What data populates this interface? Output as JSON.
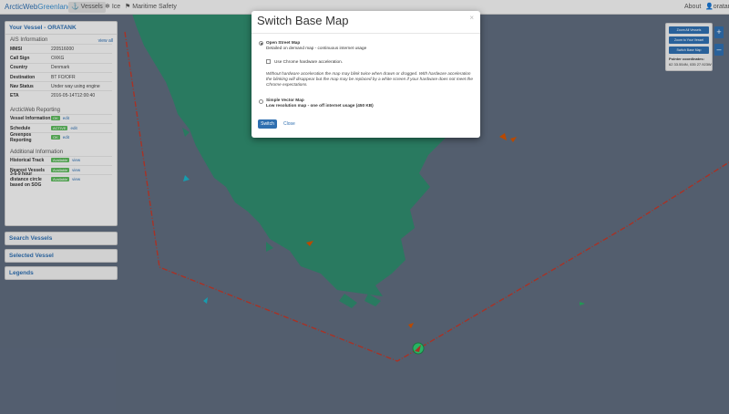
{
  "nav": {
    "brand_part1": "ArcticWeb",
    "brand_part2": "Greenland",
    "items": [
      "Vessels",
      "Ice",
      "Maritime Safety"
    ],
    "about": "About",
    "user": "oratank"
  },
  "vessel_panel": {
    "title": "Your Vessel - ORATANK",
    "ais_title": "AIS Information",
    "view_all": "view all",
    "ais_rows": [
      {
        "k": "MMSI",
        "v": "220516000"
      },
      {
        "k": "Call Sign",
        "v": "OXKG"
      },
      {
        "k": "Country",
        "v": "Denmark"
      },
      {
        "k": "Destination",
        "v": "BT FO/OFR"
      },
      {
        "k": "Nav Status",
        "v": "Under way using engine"
      },
      {
        "k": "ETA",
        "v": "2016-05-14T12:00:40"
      }
    ],
    "reporting_title": "ArcticWeb Reporting",
    "reporting_rows": [
      {
        "k": "Vessel Information",
        "badge": "OK",
        "link": "edit"
      },
      {
        "k": "Schedule",
        "badge": "ACTIVE",
        "link": "edit"
      },
      {
        "k": "Greenpos Reporting",
        "badge": "OK",
        "link": "edit"
      }
    ],
    "additional_title": "Additional Information",
    "additional_rows": [
      {
        "k": "Historical Track",
        "badge": "Available",
        "link": "view"
      },
      {
        "k": "Nearest Vessels",
        "badge": "Available",
        "link": "view"
      },
      {
        "k": "3-6-9 hour distance circle based on SOG",
        "badge": "Available",
        "link": "view"
      }
    ]
  },
  "collapsed_panels": [
    "Search Vessels",
    "Selected Vessel",
    "Legends"
  ],
  "right_panel": {
    "buttons": [
      "Zoom All Vessels",
      "Zoom to Your Vessel",
      "Switch Base Map"
    ],
    "pointer_label": "Pointer coordinates:",
    "pointer_value": "62 33.554N, 035 27.923W",
    "zoom_in": "+",
    "zoom_out": "–"
  },
  "modal": {
    "title": "Switch Base Map",
    "close_x": "×",
    "osm_title": "Open Street Map",
    "osm_desc": "Detailed on demand map - continuous internet usage",
    "chrome_label": "Use Chrome hardware acceleration.",
    "chrome_note": "Without hardware acceleration the map may blink twice when drawn or dragged. With hardware acceleration the blinking will disappear but the map may be replaced by a white screen if your hardware does not meet the Chrome expectations.",
    "vector_title": "Simple Vector Map",
    "vector_desc": "Low resolution map - one off internet usage (450 KB)",
    "switch_label": "Switch",
    "close_label": "Close",
    "selected": "osm"
  },
  "colors": {
    "sea": "#5f6b7e",
    "land": "#2f8b6e",
    "route": "#c0392b",
    "accent": "#2f6fb0"
  }
}
